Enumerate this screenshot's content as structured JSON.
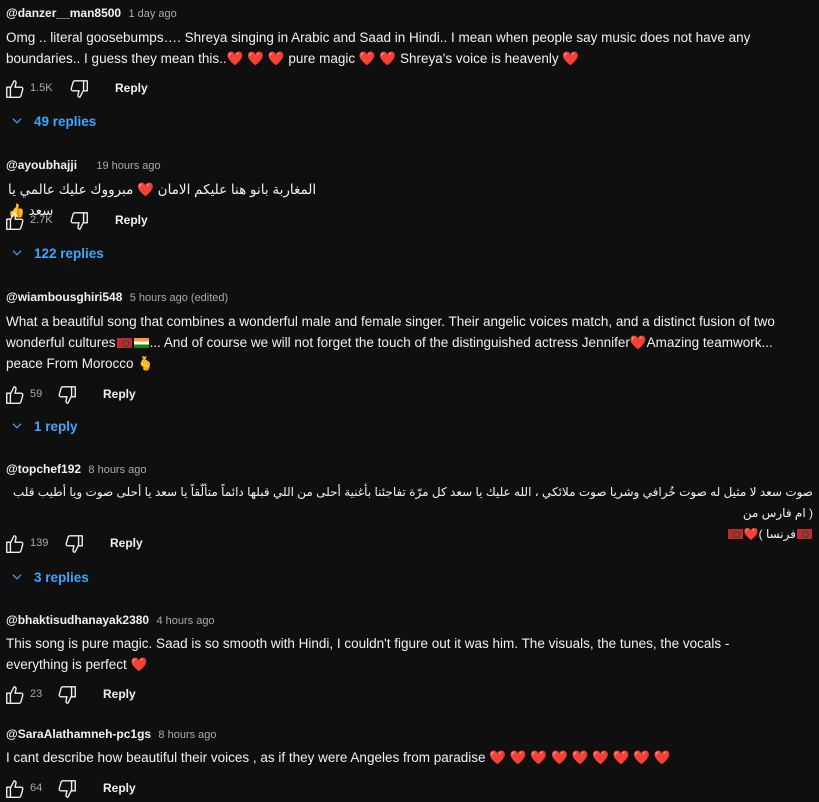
{
  "colors": {
    "background": "#0f0f0f",
    "text": "#f1f1f1",
    "muted": "#aaaaaa",
    "link": "#3ea6ff",
    "heart": "#e0292b"
  },
  "comments": [
    {
      "author": "@danzer__man8500",
      "time": "1 day ago",
      "text_line1": "Omg .. literal goosebumps…. Shreya singing in Arabic and Saad in Hindi.. I mean when people say music does not have any",
      "text_line2a": "boundaries.. I guess they mean this..",
      "hearts_a": "❤️ ❤️ ❤️",
      "text_line2b": " pure magic ",
      "hearts_b": "❤️ ❤️",
      "text_line2c": " Shreya's voice is heavenly ",
      "hearts_c": "❤️",
      "likes": "1.5K",
      "reply_label": "Reply",
      "replies_label": "49 replies"
    },
    {
      "author": "@ayoubhajji",
      "time": "19 hours ago",
      "text_a": "المغاربة بانو هنا عليكم الامان ",
      "heart": "❤️",
      "text_b": " مبرووك عليك عالمي يا سعد",
      "thumb": "👍",
      "likes": "2.7K",
      "reply_label": "Reply",
      "replies_label": "122 replies"
    },
    {
      "author": "@wiambousghiri548",
      "time": "5 hours ago (edited)",
      "text_line1": "What a beautiful song that combines a wonderful male and female singer. Their angelic voices match, and a distinct fusion of two",
      "text_line2a": "wonderful cultures",
      "text_line2b": "... And of course we will not forget the touch of the distinguished actress Jennifer",
      "heart": "❤️",
      "text_line2c": "Amazing teamwork...",
      "text_line3": "peace From Morocco ",
      "hand": "🫰",
      "likes": "59",
      "reply_label": "Reply",
      "replies_label": "1 reply"
    },
    {
      "author": "@topchef192",
      "time": "8 hours ago",
      "text_line1": "صوت سعد لا مثيل له صوت خُرافي وشريا صوت ملائكي ، الله عليك يا سعد كل مرّة تفاجئنا بأغنية أحلى من اللي قبلها دائماً متألّقاً يا سعد يا أحلى صوت ويا أطيب قلب ( ام فارس من",
      "text_line2": "فرنسا )",
      "heart": "❤️",
      "likes": "139",
      "reply_label": "Reply",
      "replies_label": "3 replies"
    },
    {
      "author": "@bhaktisudhanayak2380",
      "time": "4 hours ago",
      "text_line1": "This song is pure magic. Saad is so smooth with Hindi, I couldn't figure out it was him. The visuals, the tunes, the vocals -",
      "text_line2": "everything is perfect ",
      "heart": "❤️",
      "likes": "23",
      "reply_label": "Reply"
    },
    {
      "author": "@SaraAlathamneh-pc1gs",
      "time": "8 hours ago",
      "text_line1": "I cant describe how beautiful their voices , as if they were Angeles from paradise ",
      "hearts": "❤️ ❤️ ❤️ ❤️ ❤️ ❤️ ❤️ ❤️ ❤️",
      "likes": "64",
      "reply_label": "Reply"
    }
  ],
  "icons": {
    "like": "thumb-up-icon",
    "dislike": "thumb-down-icon",
    "expand": "chevron-down-icon",
    "flag_morocco": "morocco-flag-icon",
    "flag_india": "india-flag-icon"
  }
}
